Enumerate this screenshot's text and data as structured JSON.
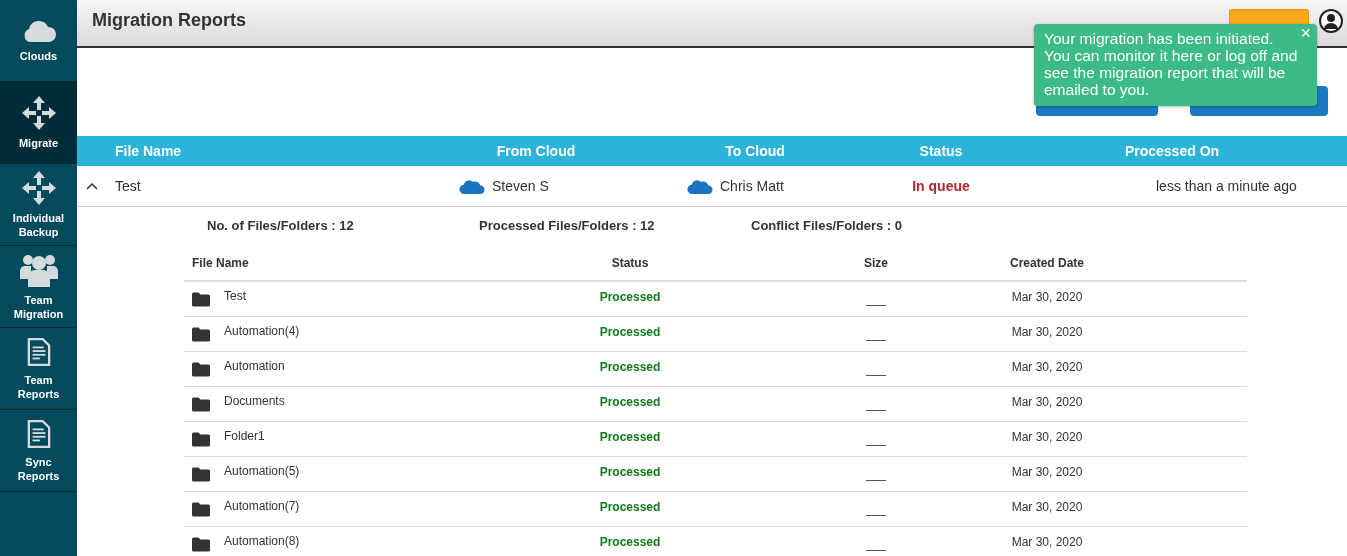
{
  "sidebar": {
    "items": [
      {
        "label": "Clouds",
        "kind": "cloud",
        "selected": false
      },
      {
        "label": "Migrate",
        "kind": "move",
        "selected": true
      },
      {
        "label": "Individual Backup",
        "kind": "move",
        "selected": false
      },
      {
        "label": "Team Migration",
        "kind": "team",
        "selected": false
      },
      {
        "label": "Team Reports",
        "kind": "report",
        "selected": false
      },
      {
        "label": "Sync Reports",
        "kind": "report",
        "selected": false
      }
    ]
  },
  "header": {
    "title": "Migration Reports"
  },
  "toast": {
    "message": "Your migration has been initiated. You can monitor it here or log off and see the migration report that will be emailed to you.",
    "close": "×"
  },
  "table": {
    "columns": [
      "File Name",
      "From Cloud",
      "To Cloud",
      "Status",
      "Processed On"
    ],
    "rows": [
      {
        "name": "Test",
        "expanded": true,
        "from": "Steven S",
        "to": "Chris Matt",
        "status": "In queue",
        "processed_on": "less than a minute ago",
        "summary": [
          "No. of Files/Folders : 12",
          "Processed Files/Folders : 12",
          "Conflict Files/Folders : 0"
        ],
        "details": {
          "columns": [
            "File Name",
            "Status",
            "Size",
            "Created Date"
          ],
          "rows": [
            {
              "name": "Test",
              "status": "Processed",
              "size": "___",
              "created": "Mar 30, 2020"
            },
            {
              "name": "Automation(4)",
              "status": "Processed",
              "size": "___",
              "created": "Mar 30, 2020"
            },
            {
              "name": "Automation",
              "status": "Processed",
              "size": "___",
              "created": "Mar 30, 2020"
            },
            {
              "name": "Documents",
              "status": "Processed",
              "size": "___",
              "created": "Mar 30, 2020"
            },
            {
              "name": "Folder1",
              "status": "Processed",
              "size": "___",
              "created": "Mar 30, 2020"
            },
            {
              "name": "Automation(5)",
              "status": "Processed",
              "size": "___",
              "created": "Mar 30, 2020"
            },
            {
              "name": "Automation(7)",
              "status": "Processed",
              "size": "___",
              "created": "Mar 30, 2020"
            },
            {
              "name": "Automation(8)",
              "status": "Processed",
              "size": "___",
              "created": "Mar 30, 2020"
            }
          ]
        }
      }
    ]
  }
}
